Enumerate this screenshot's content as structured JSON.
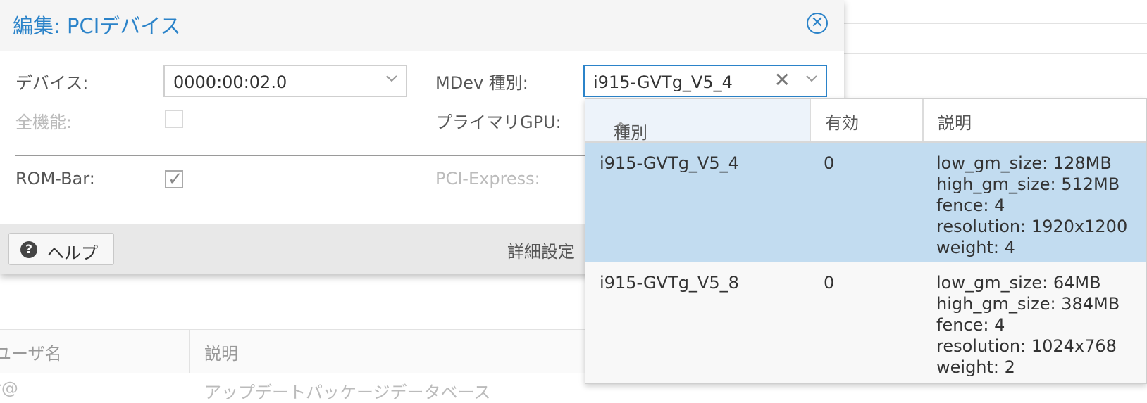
{
  "dialog": {
    "title": "編集: PCIデバイス",
    "device": {
      "label": "デバイス:",
      "value": "0000:00:02.0"
    },
    "all_functions": {
      "label": "全機能:",
      "checked": false
    },
    "mdev_type": {
      "label": "MDev 種別:",
      "value": "i915-GVTg_V5_4"
    },
    "primary_gpu": {
      "label": "プライマリGPU:"
    },
    "rom_bar": {
      "label": "ROM-Bar:",
      "checked": true
    },
    "pci_express": {
      "label": "PCI-Express:"
    },
    "footer": {
      "help_label": "ヘルプ",
      "advanced_label": "詳細設定"
    }
  },
  "picker": {
    "columns": [
      "種別",
      "有効",
      "説明"
    ],
    "sort_arrow": "↑",
    "rows": [
      {
        "type": "i915-GVTg_V5_4",
        "available": "0",
        "description": [
          "low_gm_size: 128MB",
          "high_gm_size: 512MB",
          "fence: 4",
          "resolution: 1920x1200",
          "weight: 4"
        ],
        "selected": true
      },
      {
        "type": "i915-GVTg_V5_8",
        "available": "0",
        "description": [
          "low_gm_size: 64MB",
          "high_gm_size: 384MB",
          "fence: 4",
          "resolution: 1024x768",
          "weight: 2"
        ],
        "selected": false
      }
    ]
  },
  "background_grid": {
    "col1": "ユーザ名",
    "col2": "説明",
    "row_cell1": "r@",
    "row_cell2": "アップデートパッケージデータベース"
  },
  "colors": {
    "accent": "#2b83c9",
    "selection": "#c2dcf0"
  },
  "icons": {
    "close": "close-circle-icon",
    "help": "question-circle-icon",
    "chevron": "chevron-down-icon",
    "clear": "clear-x-icon",
    "sort": "sort-asc-icon"
  }
}
